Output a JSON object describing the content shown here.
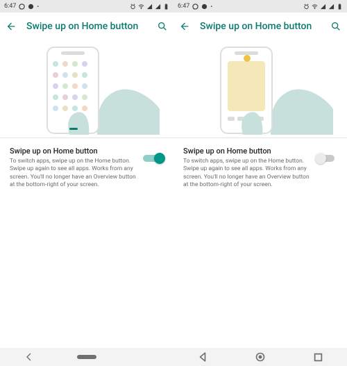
{
  "left": {
    "statusbar": {
      "time": "6:47"
    },
    "appbar": {
      "title": "Swipe up on Home button"
    },
    "setting": {
      "title": "Swipe up on Home button",
      "subtitle": "To switch apps, swipe up on the Home button. Swipe up again to see all apps. Works from any screen. You'll no longer have an Overview button at the bottom-right of your screen.",
      "enabled": true
    },
    "nav_style": "gesture"
  },
  "right": {
    "statusbar": {
      "time": "6:47"
    },
    "appbar": {
      "title": "Swipe up on Home button"
    },
    "setting": {
      "title": "Swipe up on Home button",
      "subtitle": "To switch apps, swipe up on the Home button. Swipe up again to see all apps. Works from any screen. You'll no longer have an Overview button at the bottom-right of your screen.",
      "enabled": false
    },
    "nav_style": "three_button"
  },
  "colors": {
    "accent": "#009688",
    "teal_title": "#0b7a70"
  }
}
